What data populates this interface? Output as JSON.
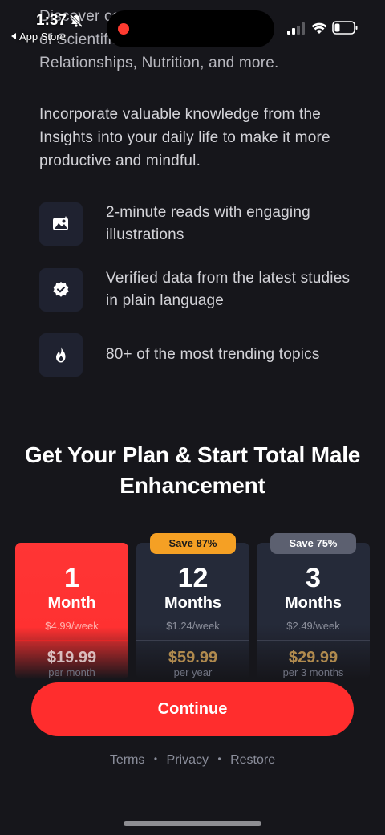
{
  "status_bar": {
    "time": "1:37",
    "back_app": "App Store"
  },
  "intro": {
    "cut_lines": [
      "Discover concise summaries",
      "of Scientific research on Health,"
    ],
    "line3": "Relationships, Nutrition, and more.",
    "paragraph2": "Incorporate valuable knowledge from the Insights into your daily life to make it more productive and mindful."
  },
  "features": [
    {
      "icon": "image-icon",
      "text": "2-minute reads with engaging illustrations"
    },
    {
      "icon": "verified-badge-icon",
      "text": "Verified data from the latest studies in plain language"
    },
    {
      "icon": "fire-icon",
      "text": "80+ of the most trending topics"
    }
  ],
  "plan_heading": "Get Your Plan & Start Total Male Enhancement",
  "plans": [
    {
      "number": "1",
      "unit": "Month",
      "per_week": "$4.99/week",
      "price": "$19.99",
      "period": "per month",
      "badge": "",
      "selected": true
    },
    {
      "number": "12",
      "unit": "Months",
      "per_week": "$1.24/week",
      "price": "$59.99",
      "period": "per year",
      "badge": "Save 87%",
      "selected": false
    },
    {
      "number": "3",
      "unit": "Months",
      "per_week": "$2.49/week",
      "price": "$29.99",
      "period": "per 3 months",
      "badge": "Save 75%",
      "selected": false
    }
  ],
  "continue_label": "Continue",
  "footer": {
    "terms": "Terms",
    "privacy": "Privacy",
    "restore": "Restore",
    "separator": "•"
  },
  "colors": {
    "background": "#16161b",
    "accent_red": "#ff2d2d",
    "card": "#252a39",
    "badge_orange": "#f5a024",
    "badge_gray": "#5c6070"
  }
}
